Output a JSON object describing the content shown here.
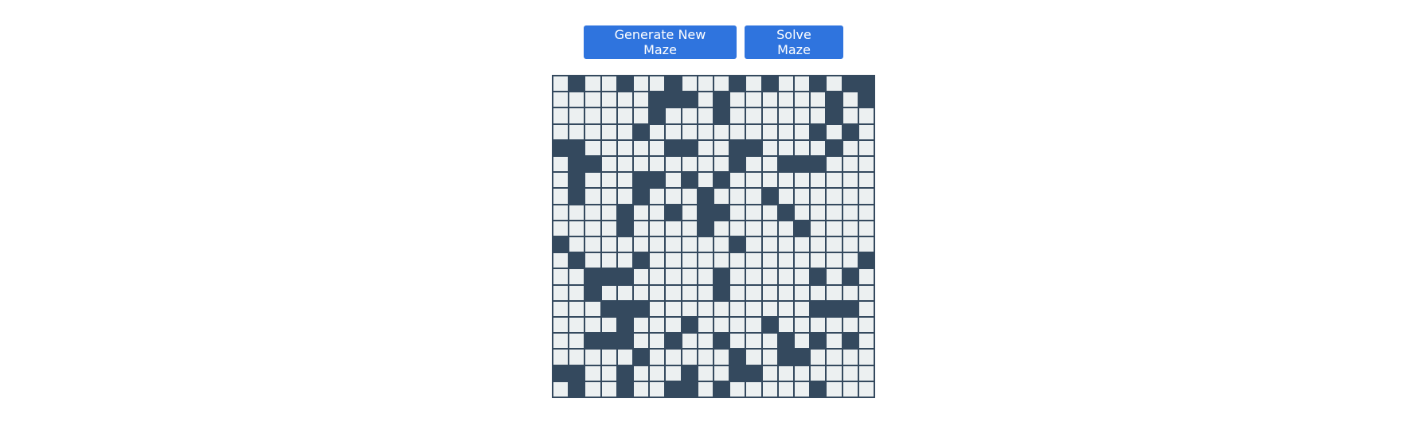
{
  "controls": {
    "generate_label": "Generate New Maze",
    "solve_label": "Solve Maze"
  },
  "colors": {
    "button": "#2f74de",
    "button_text": "#ffffff",
    "wall": "#34495e",
    "path": "#ecf0f1",
    "background": "#ffffff"
  },
  "maze": {
    "rows": 20,
    "cols": 20,
    "grid": [
      "01001001000101001011",
      "00000011101000000101",
      "00000010001000000100",
      "00000100000000001010",
      "11000001100110000100",
      "01100000000100111000",
      "01000110101000000000",
      "01000100010001000000",
      "00001001011000100000",
      "00001000010000010000",
      "10000000000100000000",
      "01000100000000000001",
      "00111000001000001010",
      "00100000001000000000",
      "00011100000000001110",
      "00001000100001000000",
      "00111001001000101010",
      "00000100000100110000",
      "11001000100110000000",
      "01001001101000001000"
    ]
  }
}
